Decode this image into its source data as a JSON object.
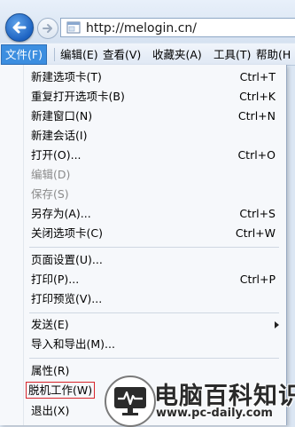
{
  "address_bar": {
    "url": "http://melogin.cn/"
  },
  "menubar": [
    {
      "label": "文件(F)",
      "active": true
    },
    {
      "label": "编辑(E)"
    },
    {
      "label": "查看(V)"
    },
    {
      "label": "收藏夹(A)"
    },
    {
      "label": "工具(T)"
    },
    {
      "label": "帮助(H"
    }
  ],
  "file_menu": {
    "new_tab": {
      "label": "新建选项卡(T)",
      "shortcut": "Ctrl+T"
    },
    "reopen_tab": {
      "label": "重复打开选项卡(B)",
      "shortcut": "Ctrl+K"
    },
    "new_window": {
      "label": "新建窗口(N)",
      "shortcut": "Ctrl+N"
    },
    "new_session": {
      "label": "新建会话(I)"
    },
    "open": {
      "label": "打开(O)...",
      "shortcut": "Ctrl+O"
    },
    "edit": {
      "label": "编辑(D)",
      "disabled": true
    },
    "save": {
      "label": "保存(S)",
      "disabled": true
    },
    "save_as": {
      "label": "另存为(A)...",
      "shortcut": "Ctrl+S"
    },
    "close_tab": {
      "label": "关闭选项卡(C)",
      "shortcut": "Ctrl+W"
    },
    "page_setup": {
      "label": "页面设置(U)..."
    },
    "print": {
      "label": "打印(P)...",
      "shortcut": "Ctrl+P"
    },
    "print_preview": {
      "label": "打印预览(V)..."
    },
    "send": {
      "label": "发送(E)"
    },
    "import_export": {
      "label": "导入和导出(M)..."
    },
    "properties": {
      "label": "属性(R)"
    },
    "work_offline": {
      "label": "脱机工作(W)"
    },
    "exit": {
      "label": "退出(X)"
    }
  },
  "watermark": {
    "title": "电脑百科知识",
    "url": "www.pc-daily.com"
  },
  "colors": {
    "menu_active": "#3c8ee0",
    "highlight_border": "#d8252b"
  }
}
